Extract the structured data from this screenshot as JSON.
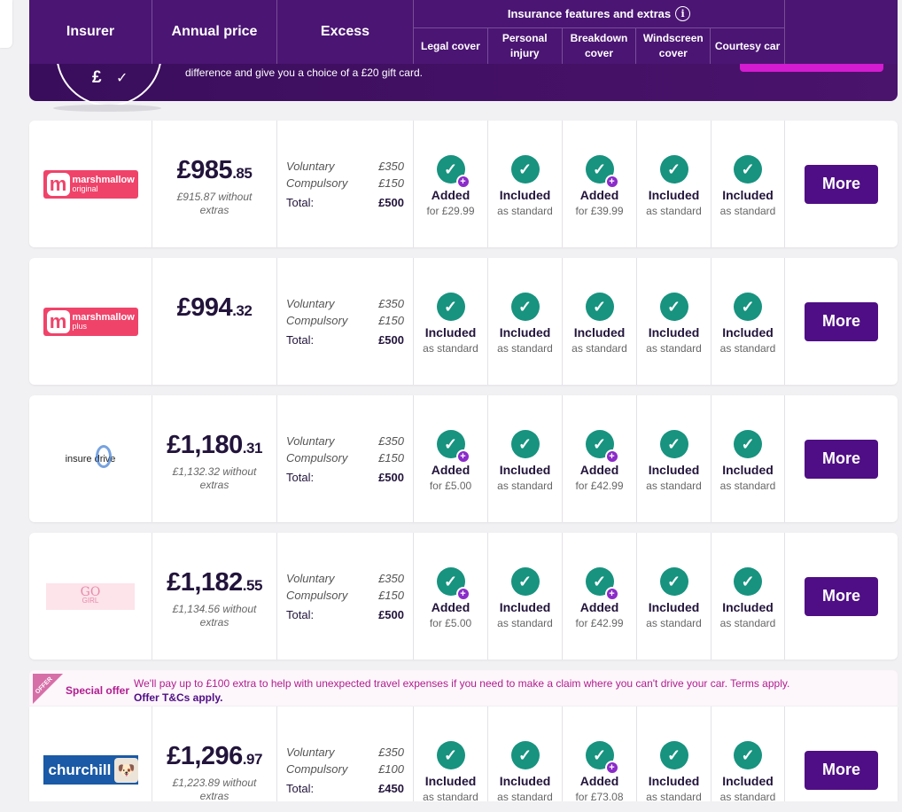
{
  "header": {
    "insurer": "Insurer",
    "annual_price": "Annual price",
    "excess": "Excess",
    "features_title": "Insurance features and extras",
    "features": [
      "Legal cover",
      "Personal injury",
      "Breakdown cover",
      "Windscreen cover",
      "Courtesy car"
    ]
  },
  "banner": {
    "text": "difference and give you a choice of a £20 gift card.",
    "pound": "£",
    "check": "✓"
  },
  "more_label": "More",
  "excess_labels": {
    "voluntary": "Voluntary",
    "compulsory": "Compulsory",
    "total": "Total:"
  },
  "quotes": [
    {
      "logo": "marshmallow-original",
      "logo_brand": "marshmallow",
      "logo_sub": "original",
      "price_main": "£985",
      "price_pence": ".85",
      "price_sub": "£915.87 without extras",
      "voluntary": "£350",
      "compulsory": "£150",
      "total": "£500",
      "features": [
        {
          "status": "Added",
          "sub": "for £29.99",
          "plus": true
        },
        {
          "status": "Included",
          "sub": "as standard",
          "plus": false
        },
        {
          "status": "Added",
          "sub": "for £39.99",
          "plus": true
        },
        {
          "status": "Included",
          "sub": "as standard",
          "plus": false
        },
        {
          "status": "Included",
          "sub": "as standard",
          "plus": false
        }
      ]
    },
    {
      "logo": "marshmallow-plus",
      "logo_brand": "marshmallow",
      "logo_sub": "plus",
      "price_main": "£994",
      "price_pence": ".32",
      "price_sub": "",
      "voluntary": "£350",
      "compulsory": "£150",
      "total": "£500",
      "features": [
        {
          "status": "Included",
          "sub": "as standard",
          "plus": false
        },
        {
          "status": "Included",
          "sub": "as standard",
          "plus": false
        },
        {
          "status": "Included",
          "sub": "as standard",
          "plus": false
        },
        {
          "status": "Included",
          "sub": "as standard",
          "plus": false
        },
        {
          "status": "Included",
          "sub": "as standard",
          "plus": false
        }
      ]
    },
    {
      "logo": "insure-drive",
      "logo_brand": "insure drive",
      "logo_sub": "",
      "price_main": "£1,180",
      "price_pence": ".31",
      "price_sub": "£1,132.32 without extras",
      "voluntary": "£350",
      "compulsory": "£150",
      "total": "£500",
      "features": [
        {
          "status": "Added",
          "sub": "for £5.00",
          "plus": true
        },
        {
          "status": "Included",
          "sub": "as standard",
          "plus": false
        },
        {
          "status": "Added",
          "sub": "for £42.99",
          "plus": true
        },
        {
          "status": "Included",
          "sub": "as standard",
          "plus": false
        },
        {
          "status": "Included",
          "sub": "as standard",
          "plus": false
        }
      ]
    },
    {
      "logo": "go-girl",
      "logo_brand": "GO",
      "logo_sub": "GIRL",
      "price_main": "£1,182",
      "price_pence": ".55",
      "price_sub": "£1,134.56 without extras",
      "voluntary": "£350",
      "compulsory": "£150",
      "total": "£500",
      "features": [
        {
          "status": "Added",
          "sub": "for £5.00",
          "plus": true
        },
        {
          "status": "Included",
          "sub": "as standard",
          "plus": false
        },
        {
          "status": "Added",
          "sub": "for £42.99",
          "plus": true
        },
        {
          "status": "Included",
          "sub": "as standard",
          "plus": false
        },
        {
          "status": "Included",
          "sub": "as standard",
          "plus": false
        }
      ]
    },
    {
      "logo": "churchill",
      "logo_brand": "churchill",
      "logo_sub": "",
      "price_main": "£1,296",
      "price_pence": ".97",
      "price_sub": "£1,223.89 without extras",
      "voluntary": "£350",
      "compulsory": "£100",
      "total": "£450",
      "features": [
        {
          "status": "Included",
          "sub": "as standard",
          "plus": false
        },
        {
          "status": "Included",
          "sub": "as standard",
          "plus": false
        },
        {
          "status": "Added",
          "sub": "for £73.08",
          "plus": true
        },
        {
          "status": "Included",
          "sub": "as standard",
          "plus": false
        },
        {
          "status": "Included",
          "sub": "as standard",
          "plus": false
        }
      ]
    }
  ],
  "offer": {
    "tag": "OFFER",
    "title": "Special offer",
    "text": "We'll pay up to £100 extra to help with unexpected travel expenses if you need to make a claim where you can't drive your car. Terms apply.",
    "link": "Offer T&Cs apply."
  },
  "colors": {
    "brand": "#4f0e85",
    "tick": "#17937f",
    "plus": "#8b2bc9",
    "offer": "#b01e8f"
  }
}
